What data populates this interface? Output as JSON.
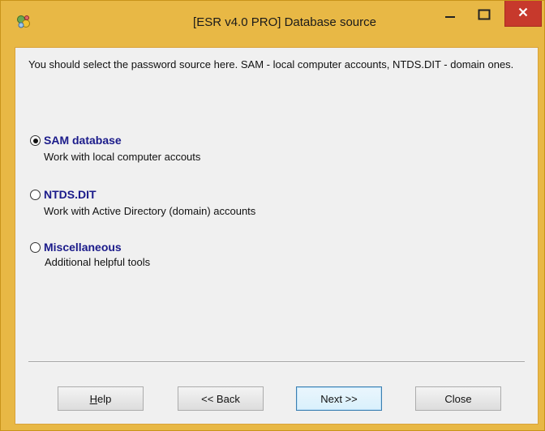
{
  "window": {
    "title": "[ESR v4.0 PRO]  Database source",
    "app_icon": "esr-app-icon",
    "controls": {
      "minimize_icon": "minimize-icon",
      "maximize_icon": "maximize-icon",
      "close_icon": "close-icon"
    },
    "colors": {
      "frame": "#e8b845",
      "close_button": "#c7392c",
      "option_title": "#1b1b8a"
    }
  },
  "description": "You should select the password source here. SAM - local computer accounts, NTDS.DIT - domain ones.",
  "options": [
    {
      "title": "SAM database",
      "description": "Work with local computer accouts",
      "selected": true
    },
    {
      "title": "NTDS.DIT",
      "description": "Work with Active Directory (domain) accounts",
      "selected": false
    },
    {
      "title": "Miscellaneous",
      "description": "Additional helpful tools",
      "selected": false
    }
  ],
  "buttons": {
    "help_accel": "H",
    "help_rest": "elp",
    "back": "<< Back",
    "next": "Next >>",
    "close": "Close"
  }
}
